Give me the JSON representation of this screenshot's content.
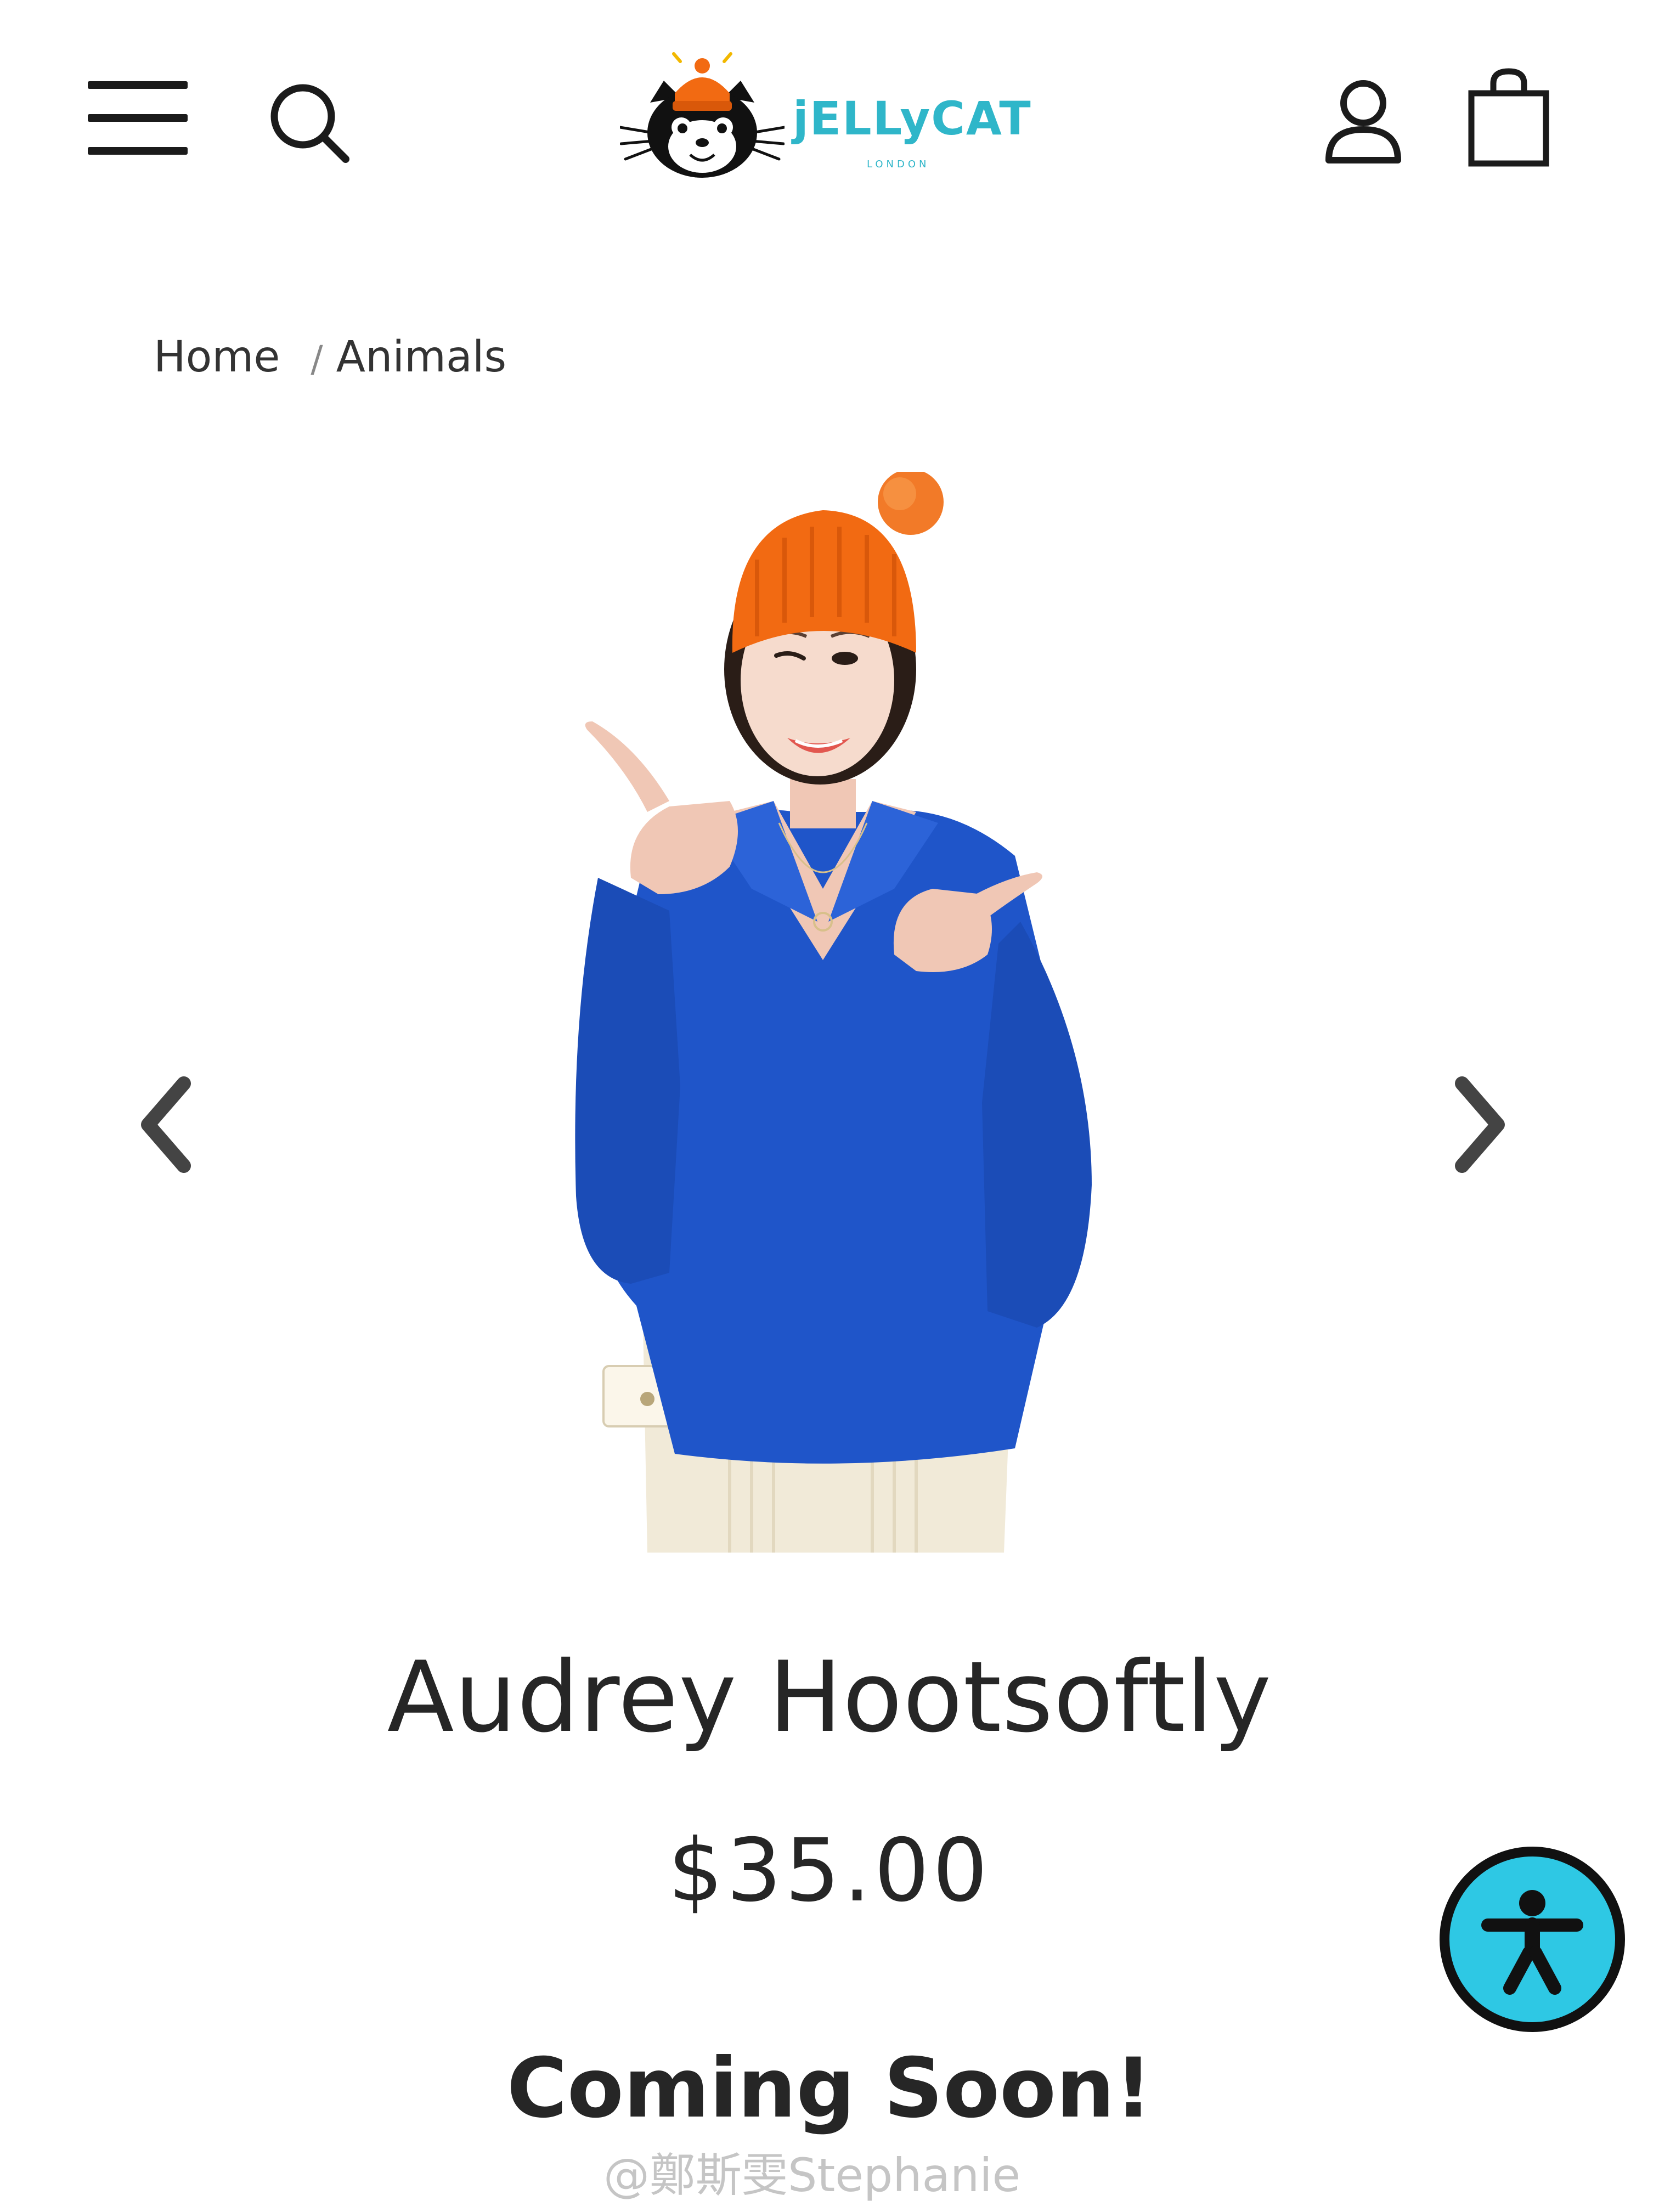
{
  "header": {
    "menu_icon": "hamburger-menu-icon",
    "search_icon": "search-icon",
    "logo_text": "jELLyCAT",
    "logo_subtext": "LONDON",
    "account_icon": "account-icon",
    "bag_icon": "shopping-bag-icon"
  },
  "breadcrumb": {
    "items": [
      "Home",
      "Animals"
    ],
    "separator": "/"
  },
  "gallery": {
    "prev_icon": "chevron-left-icon",
    "next_icon": "chevron-right-icon"
  },
  "product": {
    "title": "Audrey Hootsoftly",
    "price": "$35.00",
    "availability": "Coming Soon!"
  },
  "accessibility": {
    "icon": "accessibility-icon"
  },
  "watermark": {
    "text": "@鄭斯雯Stephanie"
  },
  "colors": {
    "brand": "#2fb6c9",
    "accessibility_button": "#2ec8e4",
    "text": "#262626",
    "hat": "#f26a12",
    "sweater": "#1f55c9"
  }
}
